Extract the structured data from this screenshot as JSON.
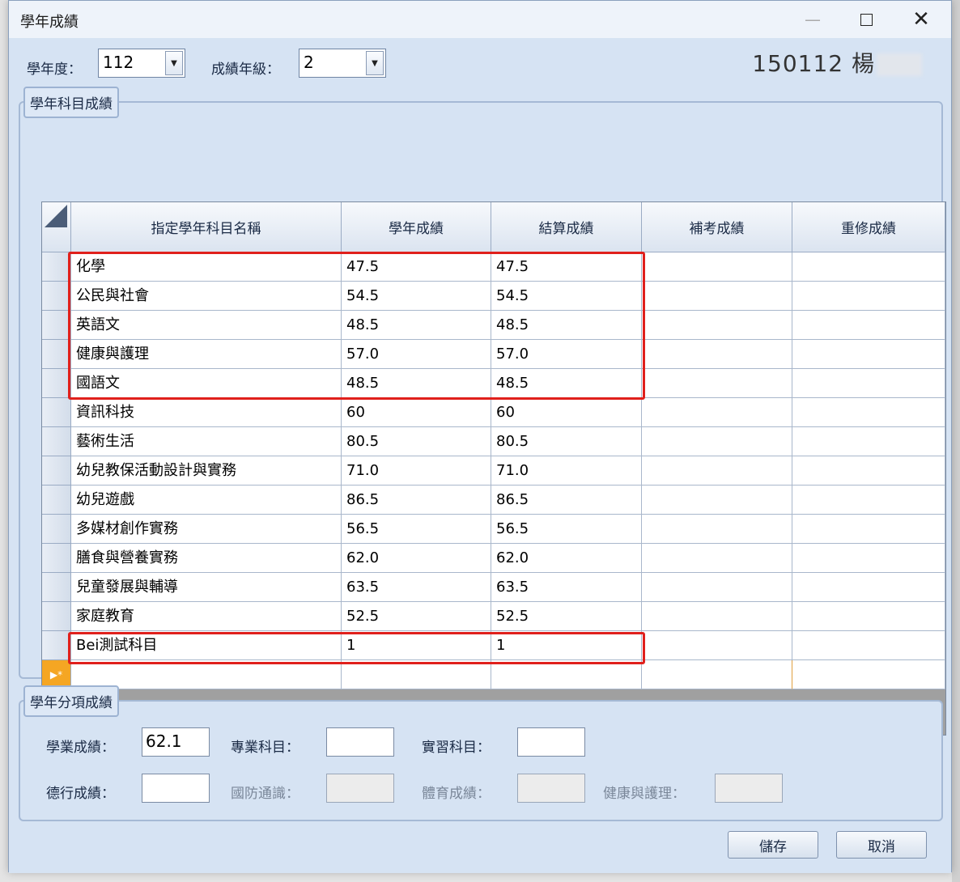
{
  "window": {
    "title": "學年成績"
  },
  "controls": {
    "year_label": "學年度：",
    "year_value": "112",
    "grade_label": "成績年級：",
    "grade_value": "2"
  },
  "student": {
    "id": "150112",
    "name": "楊"
  },
  "subject_group": {
    "title": "學年科目成績",
    "columns": [
      "指定學年科目名稱",
      "學年成績",
      "結算成績",
      "補考成績",
      "重修成績"
    ],
    "rows": [
      [
        "化學",
        "47.5",
        "47.5",
        "",
        ""
      ],
      [
        "公民與社會",
        "54.5",
        "54.5",
        "",
        ""
      ],
      [
        "英語文",
        "48.5",
        "48.5",
        "",
        ""
      ],
      [
        "健康與護理",
        "57.0",
        "57.0",
        "",
        ""
      ],
      [
        "國語文",
        "48.5",
        "48.5",
        "",
        ""
      ],
      [
        "資訊科技",
        "60",
        "60",
        "",
        ""
      ],
      [
        "藝術生活",
        "80.5",
        "80.5",
        "",
        ""
      ],
      [
        "幼兒教保活動設計與實務",
        "71.0",
        "71.0",
        "",
        ""
      ],
      [
        "幼兒遊戲",
        "86.5",
        "86.5",
        "",
        ""
      ],
      [
        "多媒材創作實務",
        "56.5",
        "56.5",
        "",
        ""
      ],
      [
        "膳食與營養實務",
        "62.0",
        "62.0",
        "",
        ""
      ],
      [
        "兒童發展與輔導",
        "63.5",
        "63.5",
        "",
        ""
      ],
      [
        "家庭教育",
        "52.5",
        "52.5",
        "",
        ""
      ],
      [
        "Bei測試科目",
        "1",
        "1",
        "",
        ""
      ]
    ]
  },
  "category_group": {
    "title": "學年分項成績",
    "academic_label": "學業成績：",
    "academic_value": "62.1",
    "major_label": "專業科目：",
    "major_value": "",
    "practice_label": "實習科目：",
    "practice_value": "",
    "conduct_label": "德行成績：",
    "conduct_value": "",
    "defense_label": "國防通識：",
    "defense_value": "",
    "pe_label": "體育成績：",
    "pe_value": "",
    "health_label": "健康與護理：",
    "health_value": ""
  },
  "buttons": {
    "save": "儲存",
    "cancel": "取消"
  },
  "colors": {
    "highlight": "#e0201c",
    "new_row": "#f5a623"
  }
}
